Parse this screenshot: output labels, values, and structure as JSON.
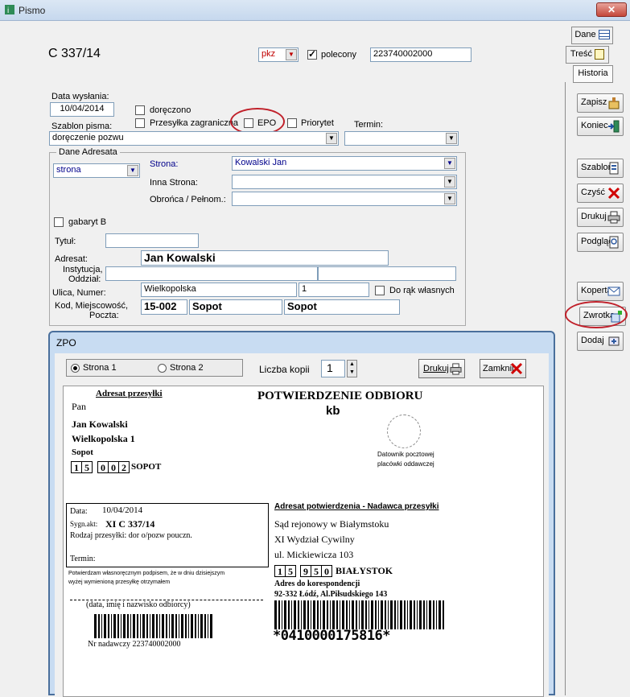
{
  "window": {
    "title": "Pismo",
    "close_glyph": "✕"
  },
  "tabs": [
    "Dane",
    "Treść",
    "Historia"
  ],
  "header": {
    "case_number": "C 337/14",
    "pkz": "pkz",
    "polecony_label": "polecony",
    "tracking_number": "223740002000"
  },
  "form": {
    "date_label": "Data wysłania:",
    "date_value": "10/04/2014",
    "doreczono_label": "doręczono",
    "zagraniczna_label": "Przesyłka zagraniczna",
    "epo_label": "EPO",
    "priorytet_label": "Priorytet",
    "szablon_label": "Szablon pisma:",
    "szablon_value": "doręczenie pozwu",
    "termin_label": "Termin:"
  },
  "addressee": {
    "group_label": "Dane Adresata",
    "type_value": "strona",
    "strona_label": "Strona:",
    "strona_value": "Kowalski Jan",
    "inna_label": "Inna Strona:",
    "obronca_label": "Obrońca / Pełnom.:",
    "gabaryt_label": "gabaryt B",
    "tytul_label": "Tytuł:",
    "adresat_label": "Adresat:",
    "adresat_value": "Jan Kowalski",
    "instytucja_label1": "Instytucja,",
    "instytucja_label2": "Oddział:",
    "ulica_label": "Ulica, Numer:",
    "ulica_value": "Wielkopolska",
    "numer_value": "1",
    "do_rak_label": "Do rąk własnych",
    "kod_label1": "Kod, Miejscowość,",
    "kod_label2": "Poczta:",
    "kod_value": "15-002",
    "miejscowosc_value": "Sopot",
    "poczta_value": "Sopot"
  },
  "side_buttons": [
    "Zapisz",
    "Koniec",
    "Szablon",
    "Czyść",
    "Drukuj",
    "Podgląd",
    "Koperta",
    "Zwrotka",
    "Dodaj"
  ],
  "dialog": {
    "title": "ZPO",
    "radio1": "Strona 1",
    "radio2": "Strona 2",
    "kopie_label": "Liczba kopii",
    "kopie_value": "1",
    "drukuj": "Drukuj",
    "zamknij": "Zamknij"
  },
  "card": {
    "adresat_header": "Adresat przesyłki",
    "heading": "POTWIERDZENIE ODBIORU",
    "kb": "kb",
    "pan": "Pan",
    "name": "Jan Kowalski",
    "street": "Wielkopolska  1",
    "city": "Sopot",
    "postal_digits": [
      "1",
      "5",
      "0",
      "0",
      "2"
    ],
    "postal_city": "SOPOT",
    "stamp_text1": "Datownik pocztowej",
    "stamp_text2": "placówki oddawczej",
    "data_label": "Data:",
    "data_value": "10/04/2014",
    "sygn_label": "Sygn.akt:",
    "sygn_value": "XI C 337/14",
    "rodzaj": "Rodzaj przesyłki: dor o/pozw pouczn.",
    "termin": "Termin:",
    "confirm1": "Potwierdzam własnoręcznym podpisem, że  w dniu dzisiejszym",
    "confirm2": "wyżej wymienioną przesyłkę otrzymałem",
    "signature": "(data, imię i nazwisko odbiorcy)",
    "nadawczy": "Nr nadawczy 223740002000",
    "nadawca_header": "Adresat potwierdzenia - Nadawca przesyłki",
    "court1": "Sąd rejonowy w Białymstoku",
    "court2": "XI Wydział Cywilny",
    "court3": "ul. Mickiewicza   103",
    "court_postal_digits": [
      "1",
      "5",
      "9",
      "5",
      "0"
    ],
    "court_city": "BIAŁYSTOK",
    "koresp_label": "Adres do korespondencji",
    "koresp_value": "92-332 Łódź, Al.Piłsudskiego 143",
    "barcode_text": "*04100001758​16*"
  }
}
